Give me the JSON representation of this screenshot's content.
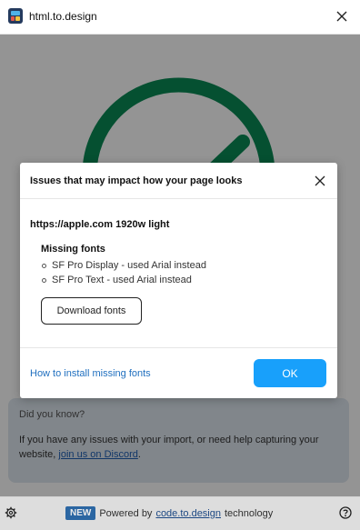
{
  "app": {
    "title": "html.to.design"
  },
  "did_you_know": {
    "title": "Did you know?",
    "body_prefix": "If you have any issues with your import, or need help capturing your website, ",
    "link_text": "join us on Discord",
    "body_suffix": "."
  },
  "footer": {
    "badge": "NEW",
    "powered_by": "Powered by",
    "link_text": "code.to.design",
    "suffix": "technology"
  },
  "modal": {
    "title": "Issues that may impact how your page looks",
    "url_line": "https://apple.com 1920w light",
    "missing_fonts_heading": "Missing fonts",
    "missing_fonts": [
      "SF Pro Display - used Arial instead",
      "SF Pro Text - used Arial instead"
    ],
    "download_button": "Download fonts",
    "install_link": "How to install missing fonts",
    "ok_button": "OK"
  },
  "colors": {
    "ring_green": "#0a8a55",
    "primary_blue": "#18a0fb",
    "badge_blue": "#2f6fb0"
  }
}
